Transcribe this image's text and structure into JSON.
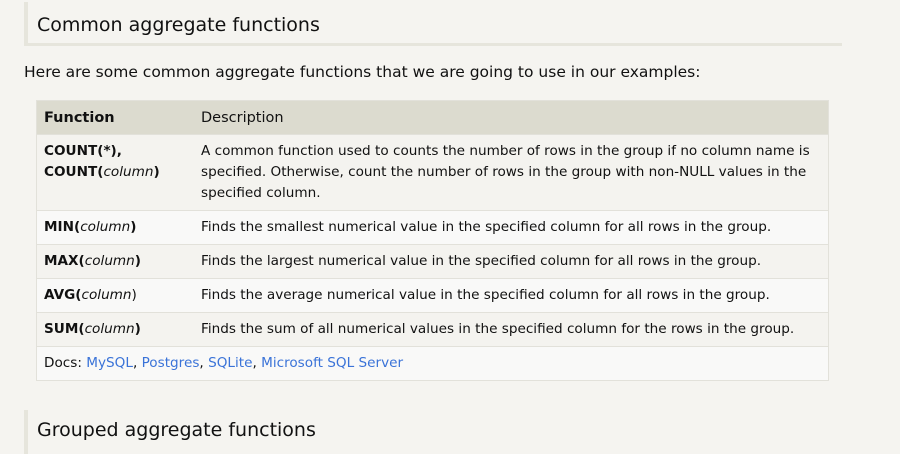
{
  "heading": "Common aggregate functions",
  "intro": "Here are some common aggregate functions that we are going to use in our examples:",
  "table": {
    "headers": [
      "Function",
      "Description"
    ],
    "rows": [
      {
        "fn": "COUNT(",
        "arg": "*",
        "close": "),",
        "fn2": "COUNT(",
        "arg2": "column",
        "close2": ")",
        "desc": "A common function used to counts the number of rows in the group if no column name is specified. Otherwise, count the number of rows in the group with non-NULL values in the specified column."
      },
      {
        "fn": "MIN(",
        "arg": "column",
        "close": ")",
        "desc": "Finds the smallest numerical value in the specified column for all rows in the group."
      },
      {
        "fn": "MAX(",
        "arg": "column",
        "close": ")",
        "desc": "Finds the largest numerical value in the specified column for all rows in the group."
      },
      {
        "fn": "AVG(",
        "arg": "column",
        "close": ")",
        "desc": "Finds the average numerical value in the specified column for all rows in the group."
      },
      {
        "fn": "SUM(",
        "arg": "column",
        "close": ")",
        "desc": "Finds the sum of all numerical values in the specified column for the rows in the group."
      }
    ],
    "docs_label": "Docs:",
    "docs_links": [
      "MySQL",
      "Postgres",
      "SQLite",
      "Microsoft SQL Server"
    ]
  },
  "next_heading": "Grouped aggregate functions"
}
